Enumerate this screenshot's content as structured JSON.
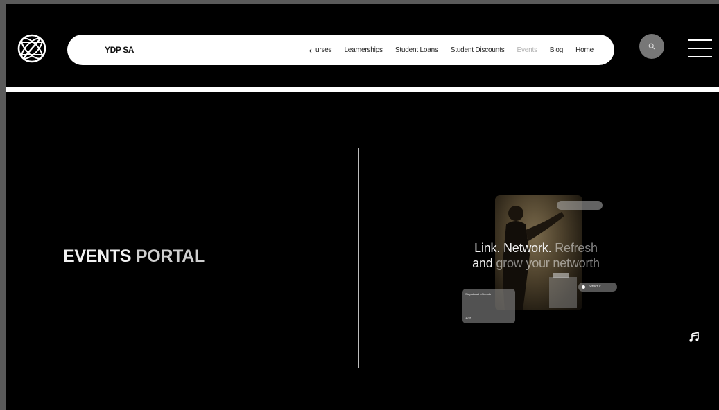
{
  "header": {
    "brand": "YDP SA",
    "nav_prev": "‹",
    "nav_items": [
      {
        "label": "urses",
        "active": false
      },
      {
        "label": "Learnerships",
        "active": false
      },
      {
        "label": "Student Loans",
        "active": false
      },
      {
        "label": "Student Discounts",
        "active": false
      },
      {
        "label": "Events",
        "active": true
      },
      {
        "label": "Blog",
        "active": false
      },
      {
        "label": "Home",
        "active": false
      }
    ],
    "icons": {
      "logo": "globe-logo-icon",
      "search": "search-icon",
      "menu": "hamburger-menu-icon"
    }
  },
  "hero": {
    "title_main": "EVENTS",
    "title_accent": "PORTAL"
  },
  "promo": {
    "line1_a": "Link. Network.",
    "line1_b": "Refresh",
    "line2_a": "and",
    "line2_b": "grow your networth",
    "card_text_top": "Stay ahead of trends",
    "card_text_bottom": "10 %",
    "pill_text": "Structur"
  },
  "icons": {
    "music": "music-note-icon"
  },
  "colors": {
    "background": "#000000",
    "navbar": "#ffffff",
    "active_nav": "#b3b3b3",
    "search_button": "#777777"
  }
}
